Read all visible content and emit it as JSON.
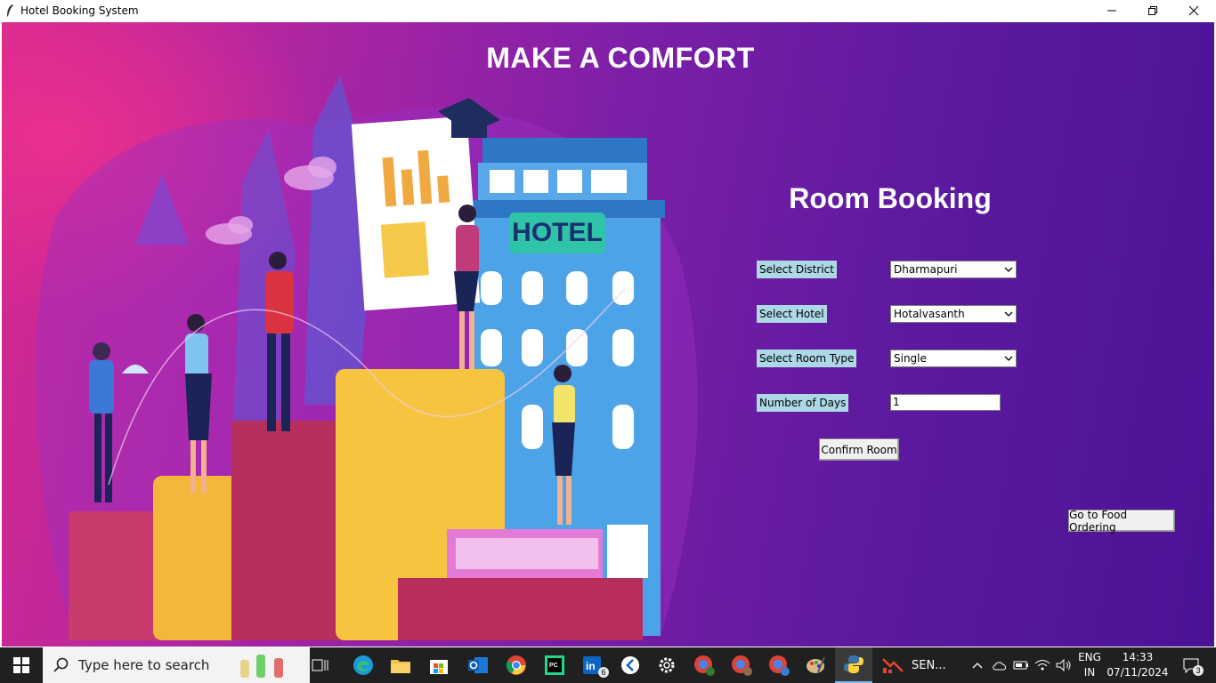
{
  "window": {
    "title": "Hotel Booking System"
  },
  "app": {
    "heading": "MAKE A COMFORT",
    "section_title": "Room Booking",
    "form": {
      "district_label": "Select District",
      "district_value": "Dharmapuri",
      "hotel_label": "Select Hotel",
      "hotel_value": "Hotalvasanth",
      "room_type_label": "Select Room Type",
      "room_type_value": "Single",
      "days_label": "Number of Days",
      "days_value": "1",
      "confirm_label": "Confirm Room"
    },
    "food_button_label": "Go to Food Ordering",
    "illustration_sign": "HOTEL"
  },
  "taskbar": {
    "search_placeholder": "Type here to search",
    "linkedin_badge": "6",
    "active_app_label": "SEN...",
    "language_line1": "ENG",
    "language_line2": "IN",
    "time": "14:33",
    "date": "07/11/2024",
    "notification_count": "3"
  },
  "colors": {
    "label_bg": "#add8e6",
    "background_left": "#d7288f",
    "background_right": "#4b1296"
  }
}
